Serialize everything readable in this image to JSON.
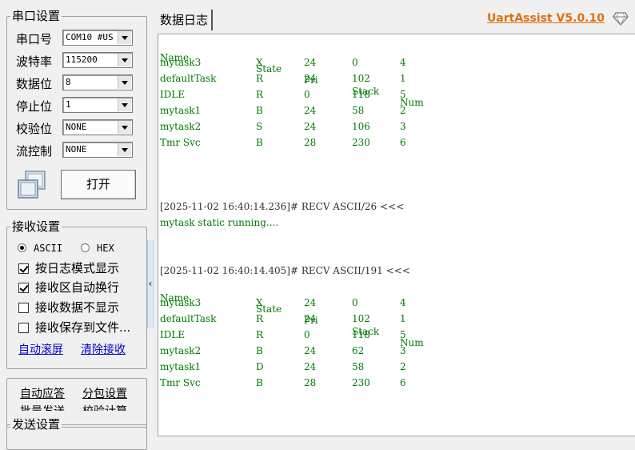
{
  "serial": {
    "legend": "串口设置",
    "fields": [
      {
        "label": "串口号",
        "value": "COM10 #US"
      },
      {
        "label": "波特率",
        "value": "115200"
      },
      {
        "label": "数据位",
        "value": "8"
      },
      {
        "label": "停止位",
        "value": "1"
      },
      {
        "label": "校验位",
        "value": "NONE"
      },
      {
        "label": "流控制",
        "value": "NONE"
      }
    ],
    "open_button": "打开",
    "port_icon": "serial-ports-icon"
  },
  "receive": {
    "legend": "接收设置",
    "radio_ascii": "ASCII",
    "radio_hex": "HEX",
    "checks": [
      {
        "label": "按日志模式显示",
        "checked": true
      },
      {
        "label": "接收区自动换行",
        "checked": true
      },
      {
        "label": "接收数据不显示",
        "checked": false
      },
      {
        "label": "接收保存到文件...",
        "checked": false
      }
    ],
    "auto_scroll": "自动滚屏",
    "clear_receive": "清除接收"
  },
  "misc": {
    "auto_reply": "自动应答",
    "packet_settings": "分包设置",
    "partial_left": "批量发送",
    "partial_right": "校验计算"
  },
  "send": {
    "legend": "发送设置"
  },
  "header": {
    "tab": "数据日志",
    "brand": "UartAssist V5.0.10",
    "brand_color": "#e07010"
  },
  "log": {
    "table1": {
      "headers": [
        "Name",
        "State",
        "Pri",
        "Stack",
        "Num"
      ],
      "rows": [
        [
          "mytask3",
          "X",
          "24",
          "0",
          "4"
        ],
        [
          "defaultTask",
          "R",
          "24",
          "102",
          "1"
        ],
        [
          "IDLE",
          "R",
          "0",
          "118",
          "5"
        ],
        [
          "mytask1",
          "B",
          "24",
          "58",
          "2"
        ],
        [
          "mytask2",
          "S",
          "24",
          "106",
          "3"
        ],
        [
          "Tmr Svc",
          "B",
          "28",
          "230",
          "6"
        ]
      ]
    },
    "recv1_header": "[2025-11-02 16:40:14.236]# RECV ASCII/26 <<<",
    "recv1_body": "mytask static running....",
    "recv2_header": "[2025-11-02 16:40:14.405]# RECV ASCII/191 <<<",
    "table2": {
      "headers": [
        "Name",
        "State",
        "Pri",
        "Stack",
        "Num"
      ],
      "rows": [
        [
          "mytask3",
          "X",
          "24",
          "0",
          "4"
        ],
        [
          "defaultTask",
          "R",
          "24",
          "102",
          "1"
        ],
        [
          "IDLE",
          "R",
          "0",
          "118",
          "5"
        ],
        [
          "mytask2",
          "B",
          "24",
          "62",
          "3"
        ],
        [
          "mytask1",
          "D",
          "24",
          "58",
          "2"
        ],
        [
          "Tmr Svc",
          "B",
          "28",
          "230",
          "6"
        ]
      ]
    }
  }
}
